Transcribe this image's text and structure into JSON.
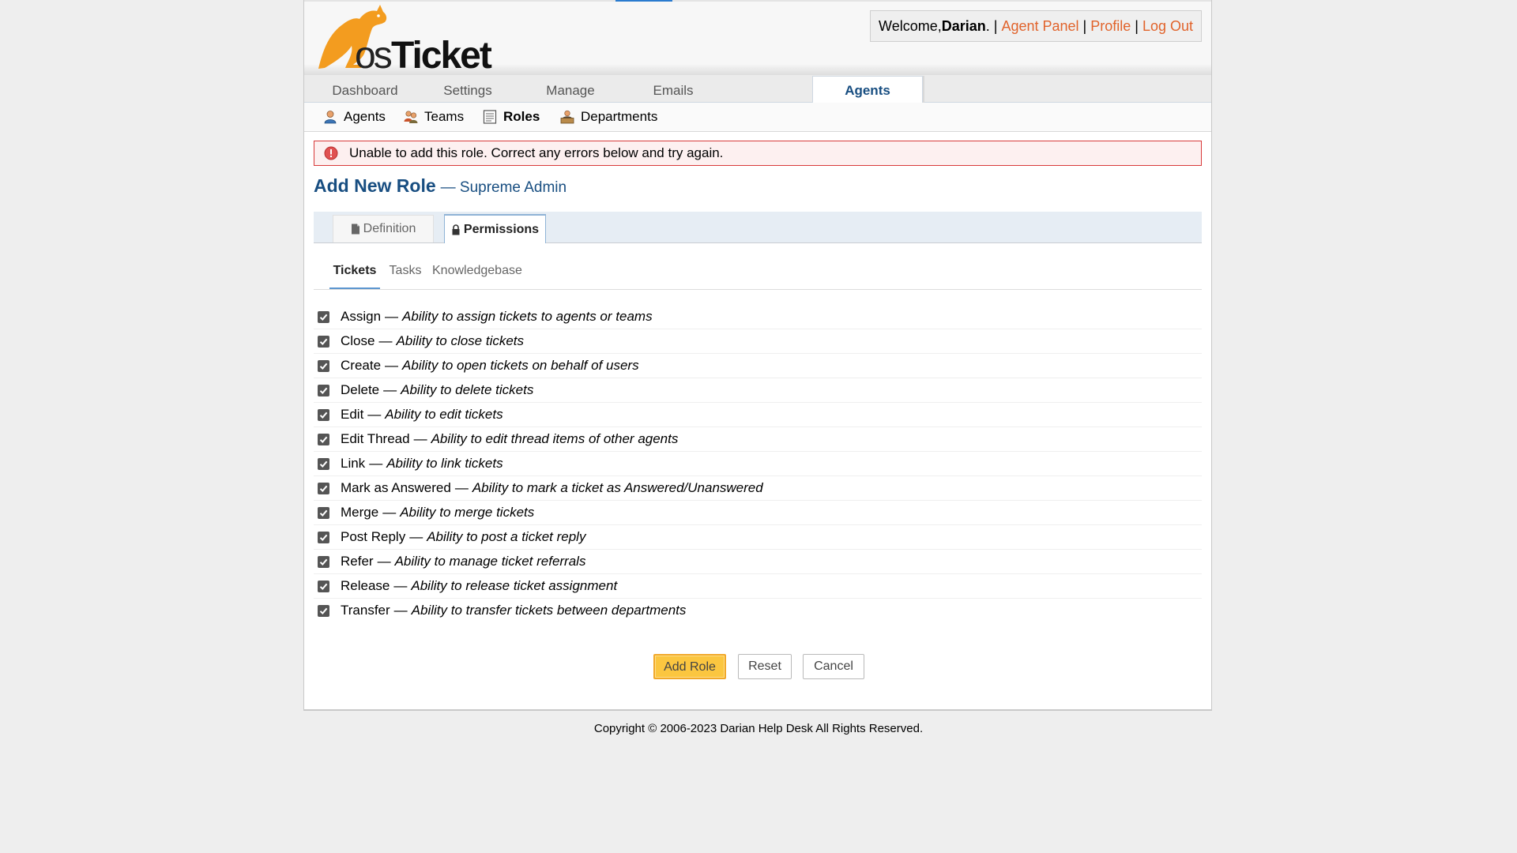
{
  "header": {
    "logo_text": "osTicket",
    "welcome_prefix": "Welcome, ",
    "user_name": "Darian",
    "welcome_suffix": ".",
    "links": [
      "Agent Panel",
      "Profile",
      "Log Out"
    ],
    "sep": "|"
  },
  "nav": {
    "tabs": [
      "Dashboard",
      "Settings",
      "Manage",
      "Emails",
      "Agents"
    ],
    "active": "Agents"
  },
  "subnav": {
    "items": [
      {
        "label": "Agents",
        "icon": "agent-icon"
      },
      {
        "label": "Teams",
        "icon": "teams-icon"
      },
      {
        "label": "Roles",
        "icon": "roles-icon"
      },
      {
        "label": "Departments",
        "icon": "departments-icon"
      }
    ],
    "active": "Roles"
  },
  "error": {
    "message": "Unable to add this role. Correct any errors below and try again.",
    "icon": "error-icon"
  },
  "page": {
    "title": "Add New Role",
    "subtitle": "— Supreme Admin"
  },
  "form_tabs": {
    "definition": "Definition",
    "permissions": "Permissions",
    "active": "Permissions"
  },
  "perm_tabs": {
    "items": [
      "Tickets",
      "Tasks",
      "Knowledgebase"
    ],
    "active": "Tickets"
  },
  "permissions": [
    {
      "name": "Assign",
      "desc": "Ability to assign tickets to agents or teams",
      "checked": true
    },
    {
      "name": "Close",
      "desc": "Ability to close tickets",
      "checked": true
    },
    {
      "name": "Create",
      "desc": "Ability to open tickets on behalf of users",
      "checked": true
    },
    {
      "name": "Delete",
      "desc": "Ability to delete tickets",
      "checked": true
    },
    {
      "name": "Edit",
      "desc": "Ability to edit tickets",
      "checked": true
    },
    {
      "name": "Edit Thread",
      "desc": "Ability to edit thread items of other agents",
      "checked": true
    },
    {
      "name": "Link",
      "desc": "Ability to link tickets",
      "checked": true
    },
    {
      "name": "Mark as Answered",
      "desc": "Ability to mark a ticket as Answered/Unanswered",
      "checked": true
    },
    {
      "name": "Merge",
      "desc": "Ability to merge tickets",
      "checked": true
    },
    {
      "name": "Post Reply",
      "desc": "Ability to post a ticket reply",
      "checked": true
    },
    {
      "name": "Refer",
      "desc": "Ability to manage ticket referrals",
      "checked": true
    },
    {
      "name": "Release",
      "desc": "Ability to release ticket assignment",
      "checked": true
    },
    {
      "name": "Transfer",
      "desc": "Ability to transfer tickets between departments",
      "checked": true
    }
  ],
  "perm_dash": "—",
  "buttons": {
    "add": "Add Role",
    "reset": "Reset",
    "cancel": "Cancel"
  },
  "footer": {
    "copyright": "Copyright © 2006-2023 Darian Help Desk All Rights Reserved."
  },
  "colors": {
    "brand_orange": "#f39c1f",
    "link_orange": "#e1632b",
    "title_blue": "#184e81",
    "error_red": "#d83a3a"
  }
}
